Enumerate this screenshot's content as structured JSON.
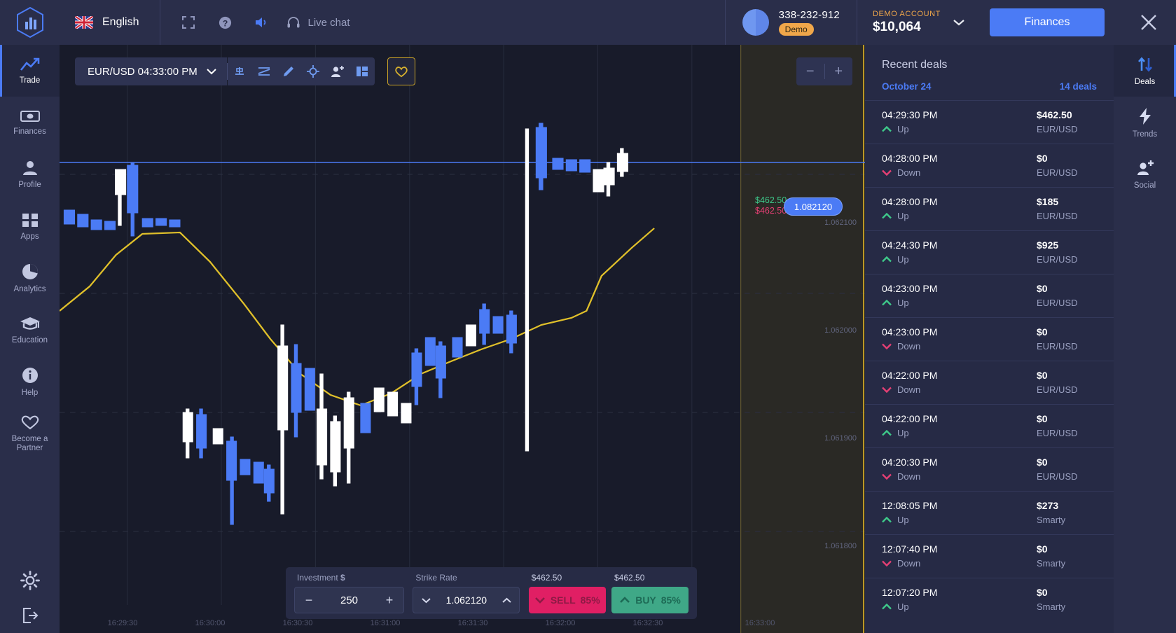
{
  "topbar": {
    "logo_icon": "bar-chart-hex-logo",
    "language": "English",
    "flag_icon": "uk-flag-icon",
    "fullscreen_icon": "fullscreen-icon",
    "help_icon": "question-circle-icon",
    "sound_icon": "speaker-icon",
    "livechat_icon": "headset-icon",
    "livechat_label": "Live chat",
    "account_id": "338-232-912",
    "account_badge": "Demo",
    "balance_title": "DEMO ACCOUNT",
    "balance_amount": "$10,064",
    "balance_chevron_icon": "chevron-down-icon",
    "finances_button": "Finances",
    "close_icon": "close-icon"
  },
  "sidebar": {
    "items": [
      {
        "label": "Trade",
        "icon": "trend-up-icon",
        "active": true
      },
      {
        "label": "Finances",
        "icon": "banknote-icon",
        "active": false
      },
      {
        "label": "Profile",
        "icon": "person-icon",
        "active": false
      },
      {
        "label": "Apps",
        "icon": "grid-icon",
        "active": false
      },
      {
        "label": "Analytics",
        "icon": "pie-chart-icon",
        "active": false
      },
      {
        "label": "Education",
        "icon": "graduation-cap-icon",
        "active": false
      },
      {
        "label": "Help",
        "icon": "info-circle-icon",
        "active": false
      },
      {
        "label": "Become a Partner",
        "icon": "heart-icon",
        "active": false
      }
    ],
    "settings_icon": "gear-icon",
    "logout_icon": "logout-icon"
  },
  "chart_toolbar": {
    "asset_label": "EUR/USD 04:33:00 PM",
    "asset_chevron_icon": "chevron-down-icon",
    "tools": [
      {
        "icon": "candle-type-icon"
      },
      {
        "icon": "indicator-line-icon"
      },
      {
        "icon": "pencil-draw-icon"
      },
      {
        "icon": "crosshair-target-icon"
      },
      {
        "icon": "add-person-icon"
      },
      {
        "icon": "layout-panels-icon"
      }
    ],
    "favorite_icon": "heart-outline-icon",
    "zoom_out_label": "−",
    "zoom_in_label": "+"
  },
  "chart_data": {
    "type": "candlestick",
    "title": "EUR/USD",
    "current_price": "1.082120",
    "profit_up": "$462.50",
    "profit_down": "$462.50",
    "price_ticks": [
      "1.062100",
      "1.062000",
      "1.061900",
      "1.061800"
    ],
    "time_ticks": [
      "16:29:30",
      "16:30:00",
      "16:30:30",
      "16:31:00",
      "16:31:30",
      "16:32:00",
      "16:32:30",
      "16:33:00"
    ],
    "strike_line_price": "1.082120",
    "ma_line_color": "#e0c02a",
    "candle_up_color": "#4b7bf5",
    "candle_down_color": "#ffffff",
    "grid": true
  },
  "trade_panel": {
    "investment_label": "Investment",
    "investment_currency": "$",
    "investment_value": "250",
    "investment_minus": "−",
    "investment_plus": "+",
    "strike_label": "Strike Rate",
    "strike_value": "1.062120",
    "strike_down_icon": "chevron-down-icon",
    "strike_up_icon": "chevron-up-icon",
    "sell_payout": "$462.50",
    "buy_payout": "$462.50",
    "sell_label": "SELL",
    "sell_percent": "85%",
    "sell_icon": "chevron-down-icon",
    "buy_label": "BUY",
    "buy_percent": "85%",
    "buy_icon": "chevron-up-icon"
  },
  "deals": {
    "title": "Recent deals",
    "date": "October 24",
    "count": "14 deals",
    "rows": [
      {
        "time": "04:29:30 PM",
        "dir": "Up",
        "amount": "$462.50",
        "asset": "EUR/USD"
      },
      {
        "time": "04:28:00 PM",
        "dir": "Down",
        "amount": "$0",
        "asset": "EUR/USD"
      },
      {
        "time": "04:28:00 PM",
        "dir": "Up",
        "amount": "$185",
        "asset": "EUR/USD"
      },
      {
        "time": "04:24:30 PM",
        "dir": "Up",
        "amount": "$925",
        "asset": "EUR/USD"
      },
      {
        "time": "04:23:00 PM",
        "dir": "Up",
        "amount": "$0",
        "asset": "EUR/USD"
      },
      {
        "time": "04:23:00 PM",
        "dir": "Down",
        "amount": "$0",
        "asset": "EUR/USD"
      },
      {
        "time": "04:22:00 PM",
        "dir": "Down",
        "amount": "$0",
        "asset": "EUR/USD"
      },
      {
        "time": "04:22:00 PM",
        "dir": "Up",
        "amount": "$0",
        "asset": "EUR/USD"
      },
      {
        "time": "04:20:30 PM",
        "dir": "Down",
        "amount": "$0",
        "asset": "EUR/USD"
      },
      {
        "time": "12:08:05 PM",
        "dir": "Up",
        "amount": "$273",
        "asset": "Smarty"
      },
      {
        "time": "12:07:40 PM",
        "dir": "Down",
        "amount": "$0",
        "asset": "Smarty"
      },
      {
        "time": "12:07:20 PM",
        "dir": "Up",
        "amount": "$0",
        "asset": "Smarty"
      }
    ]
  },
  "rightnav": {
    "items": [
      {
        "label": "Deals",
        "icon": "arrows-up-down-icon",
        "active": true
      },
      {
        "label": "Trends",
        "icon": "lightning-bolt-icon",
        "active": false
      },
      {
        "label": "Social",
        "icon": "add-person-icon",
        "active": false
      }
    ]
  },
  "colors": {
    "accent": "#4b7bf5",
    "up": "#3ec98a",
    "down": "#e53f74",
    "warn": "#f0a74a",
    "ma_line": "#e0c02a"
  }
}
